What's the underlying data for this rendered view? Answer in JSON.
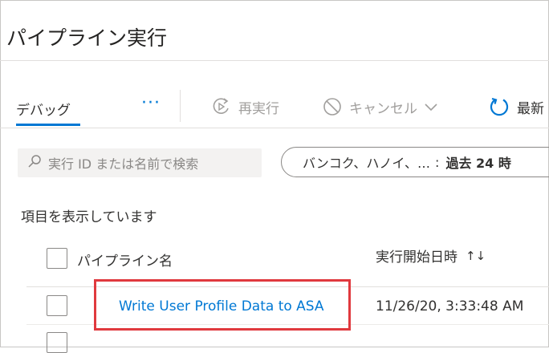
{
  "page": {
    "title": "パイプライン実行"
  },
  "tabs": [
    {
      "label": "デバッグ",
      "active": true
    }
  ],
  "toolbar": {
    "more_label": "···",
    "rerun_label": "再実行",
    "cancel_label": "キャンセル",
    "refresh_label": "最新"
  },
  "search": {
    "placeholder": "実行 ID または名前で検索"
  },
  "filter": {
    "timezone": "バンコク、ハノイ、…",
    "separator": ":",
    "range": "過去 24 時"
  },
  "list": {
    "status_text": "項目を表示しています",
    "columns": [
      {
        "label": "パイプライン名"
      },
      {
        "label": "実行開始日時",
        "sort_icon": "↑↓"
      }
    ],
    "rows": [
      {
        "pipeline_name": "Write User Profile Data to ASA",
        "run_start": "11/26/20, 3:33:48 AM"
      }
    ]
  },
  "colors": {
    "accent": "#0078d4",
    "highlight_border": "#e0393e",
    "disabled_text": "#a19f9d"
  }
}
